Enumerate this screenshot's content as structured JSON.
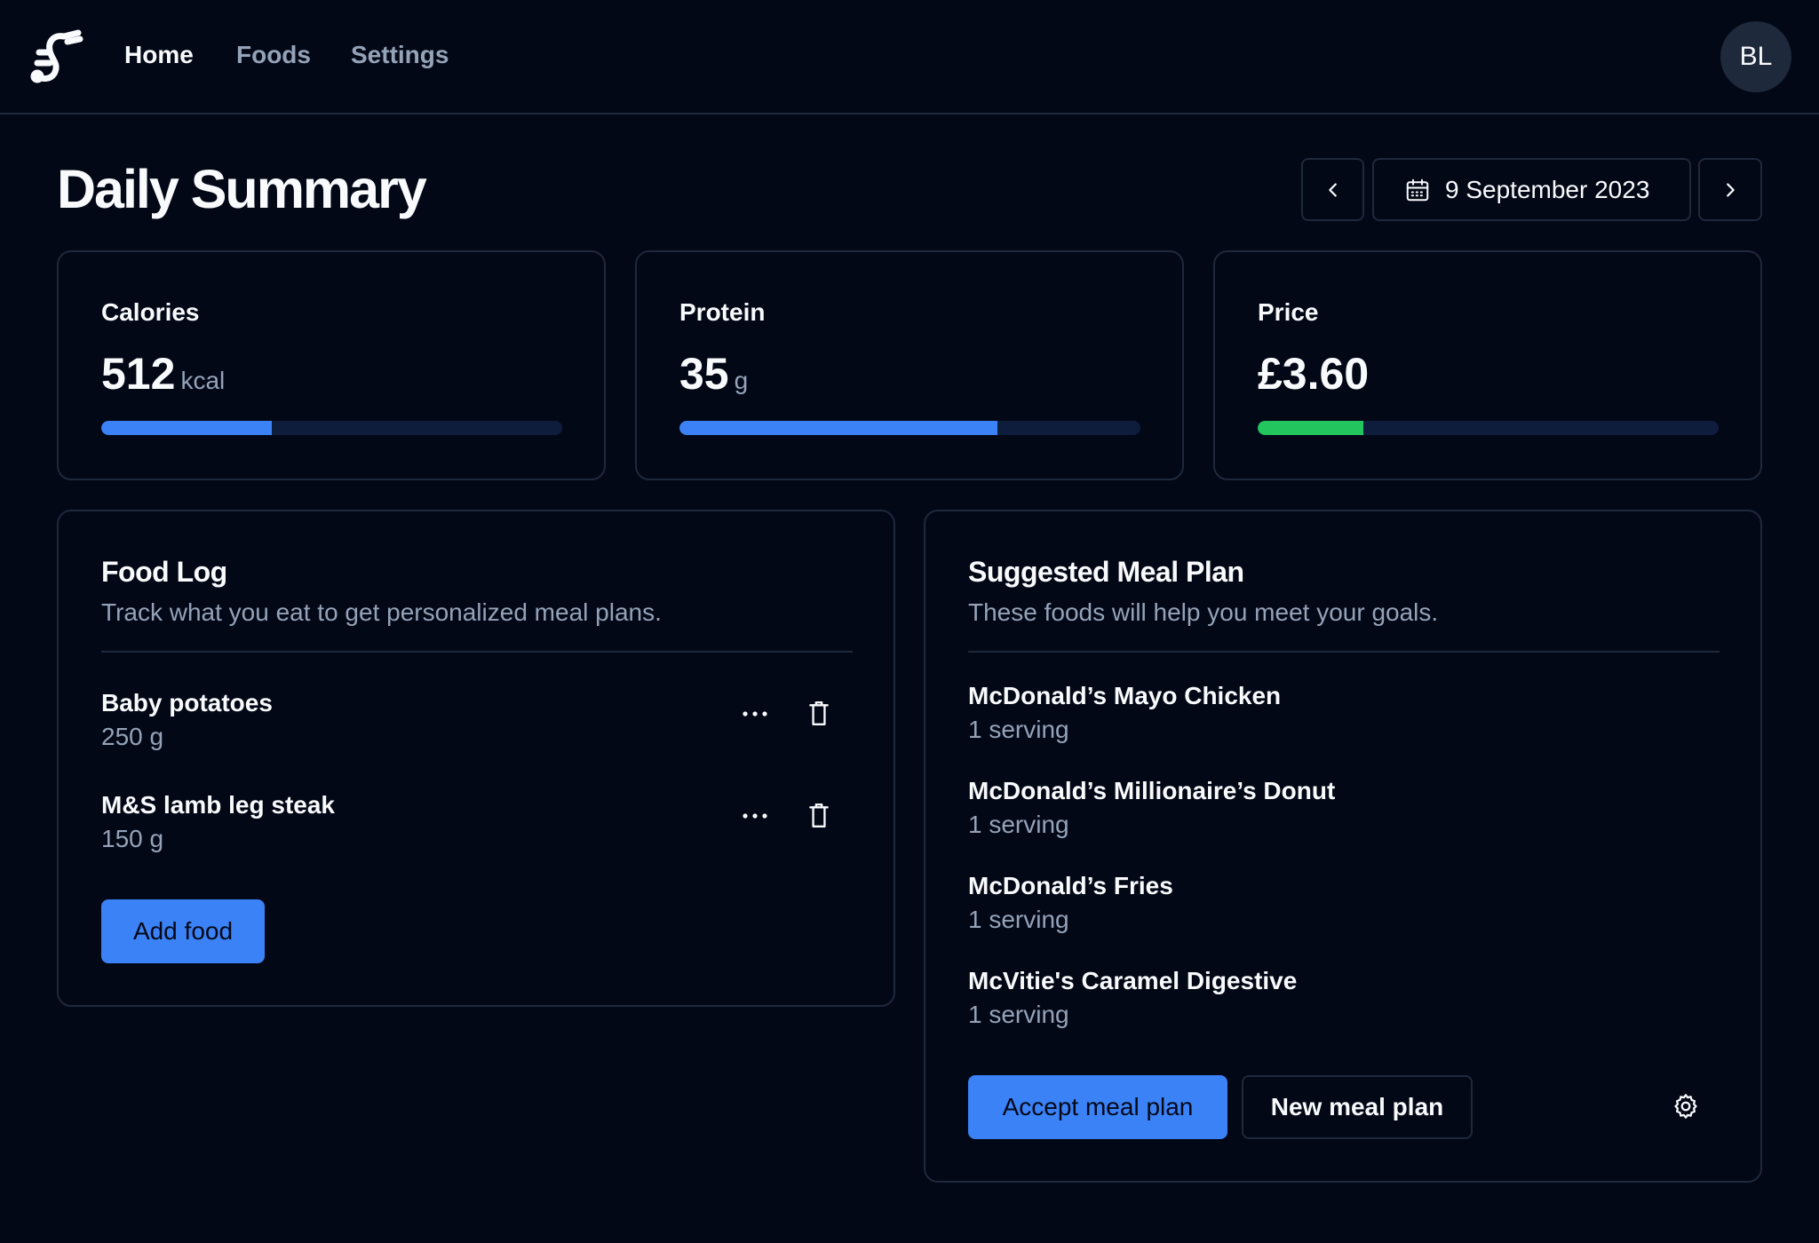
{
  "nav": {
    "links": [
      {
        "label": "Home",
        "active": true
      },
      {
        "label": "Foods",
        "active": false
      },
      {
        "label": "Settings",
        "active": false
      }
    ],
    "avatar_initials": "BL"
  },
  "page": {
    "title": "Daily Summary",
    "date": "9 September 2023"
  },
  "stats": [
    {
      "label": "Calories",
      "value": "512",
      "unit": "kcal",
      "progress": 0.37,
      "color": "#3b82f6"
    },
    {
      "label": "Protein",
      "value": "35",
      "unit": "g",
      "progress": 0.69,
      "color": "#3b82f6"
    },
    {
      "label": "Price",
      "value": "£3.60",
      "unit": "",
      "progress": 0.23,
      "color": "#22c55e"
    }
  ],
  "food_log": {
    "title": "Food Log",
    "subtitle": "Track what you eat to get personalized meal plans.",
    "items": [
      {
        "name": "Baby potatoes",
        "qty": "250 g"
      },
      {
        "name": "M&S lamb leg steak",
        "qty": "150 g"
      }
    ],
    "add_label": "Add food"
  },
  "meal_plan": {
    "title": "Suggested Meal Plan",
    "subtitle": "These foods will help you meet your goals.",
    "items": [
      {
        "name": "McDonald’s Mayo Chicken",
        "qty": "1 serving"
      },
      {
        "name": "McDonald’s Millionaire’s Donut",
        "qty": "1 serving"
      },
      {
        "name": "McDonald’s Fries",
        "qty": "1 serving"
      },
      {
        "name": "McVitie's Caramel Digestive",
        "qty": "1 serving"
      }
    ],
    "accept_label": "Accept meal plan",
    "new_label": "New meal plan"
  },
  "colors": {
    "background": "#030817",
    "accent": "#3b82f6",
    "success": "#22c55e",
    "border": "#1e293b",
    "muted_text": "#94a3b8"
  }
}
